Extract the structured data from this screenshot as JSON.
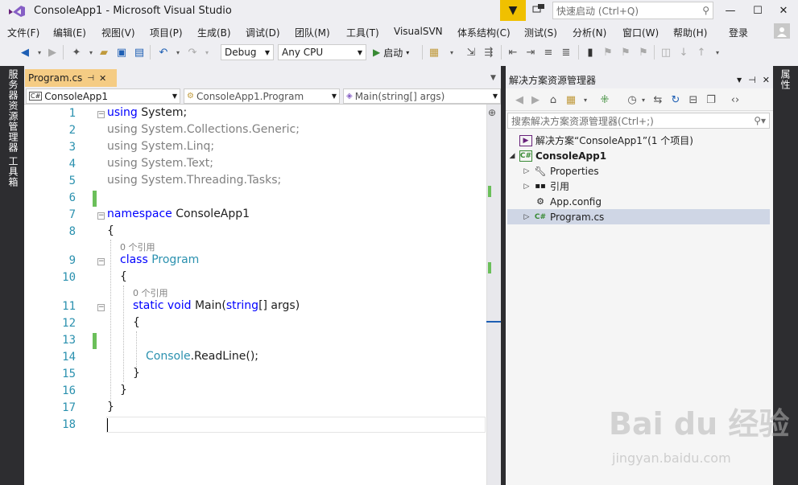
{
  "window": {
    "title": "ConsoleApp1 - Microsoft Visual Studio",
    "quick_launch_placeholder": "快速启动 (Ctrl+Q)"
  },
  "menu": [
    "文件(F)",
    "编辑(E)",
    "视图(V)",
    "项目(P)",
    "生成(B)",
    "调试(D)",
    "团队(M)",
    "工具(T)",
    "VisualSVN",
    "体系结构(C)",
    "测试(S)",
    "分析(N)",
    "窗口(W)",
    "帮助(H)"
  ],
  "account": {
    "login_label": "登录"
  },
  "toolbar": {
    "config": "Debug",
    "platform": "Any CPU",
    "start_label": "启动"
  },
  "left_strip": {
    "server_explorer": "服务器资源管理器",
    "toolbox": "工具箱"
  },
  "right_strip": {
    "properties": "属性"
  },
  "editor": {
    "tab_label": "Program.cs",
    "nav": {
      "project": "ConsoleApp1",
      "class": "ConsoleApp1.Program",
      "member": "Main(string[] args)"
    },
    "line_numbers": [
      "1",
      "2",
      "3",
      "4",
      "5",
      "6",
      "7",
      "8",
      "9",
      "10",
      "11",
      "12",
      "13",
      "14",
      "15",
      "16",
      "17",
      "18"
    ],
    "refs_label": "0 个引用",
    "code": {
      "l1_kw": "using",
      "l1_rest": " System;",
      "l2": "using System.Collections.Generic;",
      "l3": "using System.Linq;",
      "l4": "using System.Text;",
      "l5": "using System.Threading.Tasks;",
      "l7_kw": "namespace",
      "l7_rest": " ConsoleApp1",
      "brace_open": "{",
      "brace_close": "}",
      "l9_kw": "class",
      "l9_ty": " Program",
      "l11_kw": "static void",
      "l11_name": " Main(",
      "l11_ty": "string",
      "l11_rest": "[] args)",
      "l14_ty": "Console",
      "l14_rest": ".ReadLine();"
    }
  },
  "solution_explorer": {
    "title": "解决方案资源管理器",
    "search_placeholder": "搜索解决方案资源管理器(Ctrl+;)",
    "tree": [
      {
        "label": "解决方案“ConsoleApp1”(1 个项目)",
        "icon": "solution-icon"
      },
      {
        "label": "ConsoleApp1",
        "icon": "csharp-project-icon"
      },
      {
        "label": "Properties",
        "icon": "wrench-icon"
      },
      {
        "label": "引用",
        "icon": "references-icon"
      },
      {
        "label": "App.config",
        "icon": "config-file-icon"
      },
      {
        "label": "Program.cs",
        "icon": "csharp-file-icon"
      }
    ]
  },
  "watermark": {
    "brand": "Bai du 经验",
    "url": "jingyan.baidu.com"
  },
  "colors": {
    "keyword": "#0000ff",
    "type": "#2b91af",
    "tab_active": "#f5cc84",
    "dark_frame": "#2d2d30",
    "change_bar": "#6bbf5a"
  }
}
